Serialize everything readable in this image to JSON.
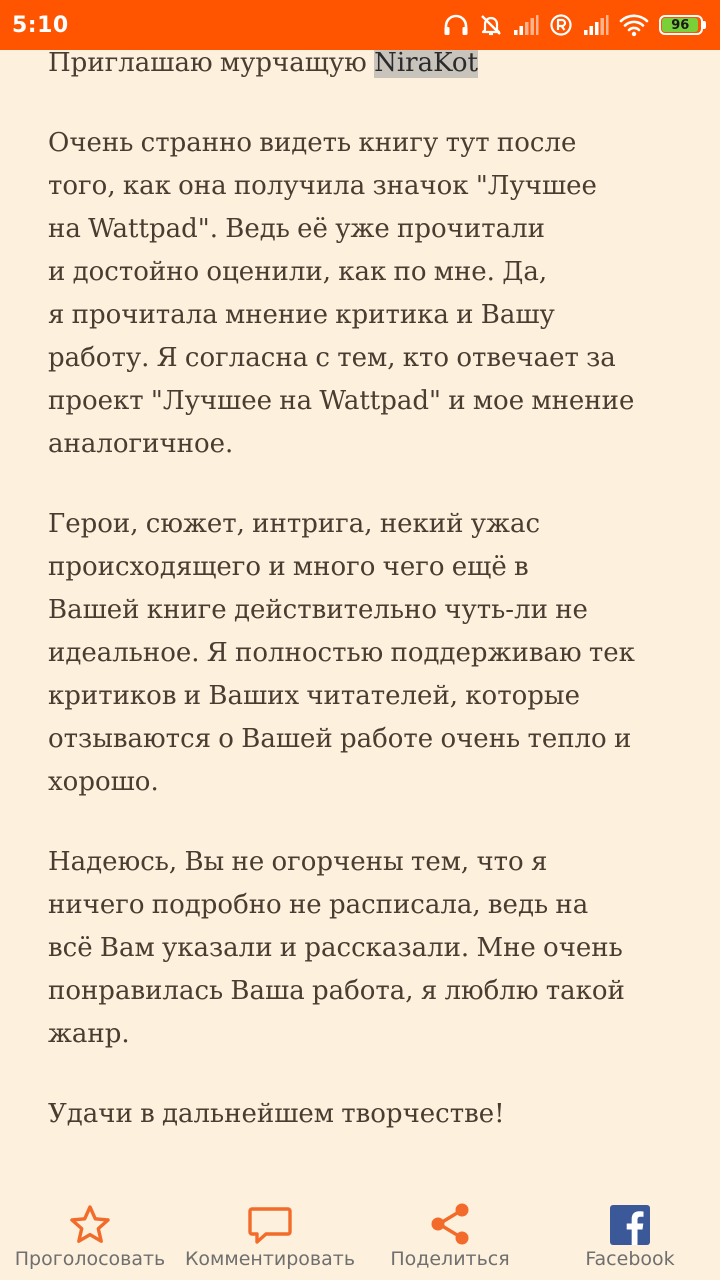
{
  "status_bar": {
    "time": "5:10",
    "battery_level": "96",
    "icons": [
      "headphones-icon",
      "bell-off-icon",
      "signal-icon",
      "registered-icon",
      "signal-icon",
      "wifi-icon",
      "battery-icon"
    ],
    "colors": {
      "background": "#ff5500",
      "battery_fill": "#7bd03a"
    }
  },
  "content": {
    "line0": {
      "before": "Приглашаю мурчащую ",
      "highlight": "NiraKot"
    },
    "paragraphs": [
      [
        "Очень странно видеть книгу тут после",
        "того, как она получила значок \"Лучшее",
        "на Wattpad\". Ведь её уже прочитали",
        "и достойно оценили, как по мне. Да,",
        "я прочитала мнение критика и Вашу",
        "работу. Я согласна с тем, кто отвечает за",
        "проект \"Лучшее на Wattpad\" и мое мнение",
        "аналогичное."
      ],
      [
        "Герои, сюжет, интрига, некий ужас",
        "происходящего и много чего ещё в",
        "Вашей книге действительно чуть-ли не",
        "идеальное. Я полностью поддерживаю тек",
        "критиков и Ваших читателей, которые",
        "отзываются о Вашей работе очень тепло и",
        "хорошо."
      ],
      [
        "Надеюсь, Вы не огорчены тем, что я",
        "ничего подробно не расписала, ведь на",
        "всё Вам указали и рассказали. Мне очень",
        "понравилась Ваша работа, я люблю такой",
        "жанр."
      ],
      [
        "Удачи в дальнейшем творчестве!"
      ]
    ],
    "colors": {
      "background": "#fdf0dc",
      "text": "#4b3c31",
      "highlight": "#c8c3bb"
    }
  },
  "bottom_bar": {
    "vote_label": "Проголосовать",
    "comment_label": "Комментировать",
    "share_label": "Поделиться",
    "facebook_label": "Facebook",
    "colors": {
      "accent": "#f26b2a",
      "facebook": "#3b5998",
      "label": "#6f6f6f"
    }
  }
}
